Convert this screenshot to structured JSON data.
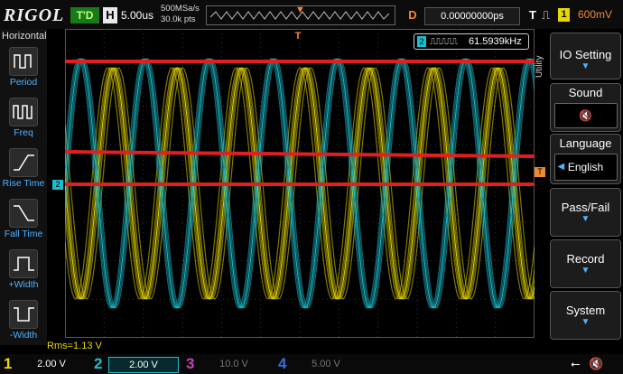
{
  "header": {
    "brand": "RIGOL",
    "run_status": "T'D",
    "horizontal_label": "H",
    "timebase": "5.00us",
    "sample_rate": "500MSa/s",
    "memory_depth": "30.0k pts",
    "delay_label": "D",
    "delay": "0.00000000ps",
    "trigger_label": "T",
    "trigger_source": "1",
    "trigger_level": "600mV"
  },
  "left_menu": {
    "title": "Horizontal",
    "items": [
      {
        "label": "Period",
        "icon": "period-icon"
      },
      {
        "label": "Freq",
        "icon": "freq-icon"
      },
      {
        "label": "Rise Time",
        "icon": "rise-time-icon"
      },
      {
        "label": "Fall Time",
        "icon": "fall-time-icon"
      },
      {
        "label": "+Width",
        "icon": "pos-width-icon"
      },
      {
        "label": "-Width",
        "icon": "neg-width-icon"
      }
    ]
  },
  "measurement": {
    "freq_channel": "2",
    "freq_value": "61.5939kHz",
    "rms_readout": "Rms=1.13 V"
  },
  "markers": {
    "trigger_position": "T",
    "ch2_ground": "2",
    "trigger_level": "T"
  },
  "right_menu": {
    "title": "Utility",
    "buttons": [
      {
        "label": "IO Setting"
      },
      {
        "label": "Sound",
        "value_icon": "mute-icon"
      },
      {
        "label": "Language",
        "value": "English"
      },
      {
        "label": "Pass/Fail"
      },
      {
        "label": "Record"
      },
      {
        "label": "System"
      }
    ]
  },
  "channels": [
    {
      "num": "1",
      "scale": "2.00 V",
      "color": "#e8d800"
    },
    {
      "num": "2",
      "scale": "2.00 V",
      "color": "#19c0d0"
    },
    {
      "num": "3",
      "scale": "10.0 V",
      "color": "#c040c0"
    },
    {
      "num": "4",
      "scale": "5.00 V",
      "color": "#3a6ae0"
    }
  ],
  "colors": {
    "ch1": "#e8d800",
    "ch2": "#19c0d0",
    "overlay_lines": "#e02020",
    "accent": "#f08a2a"
  }
}
